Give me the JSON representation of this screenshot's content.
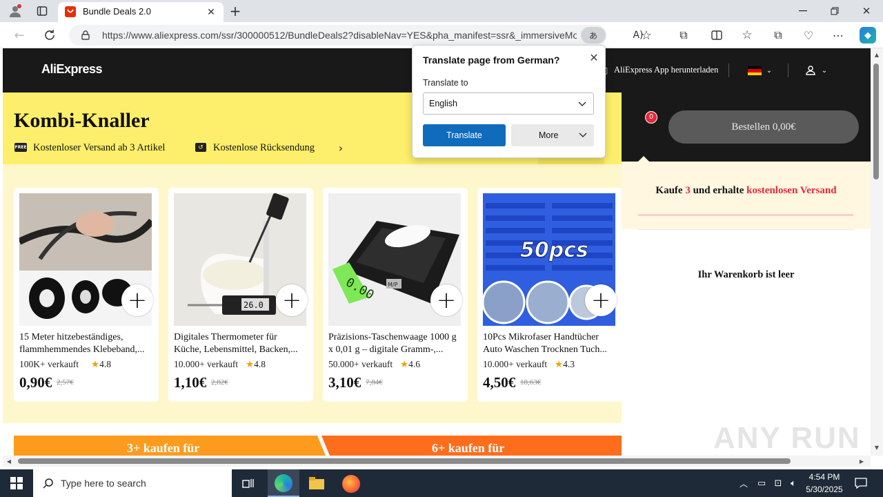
{
  "browser": {
    "tab_title": "Bundle Deals 2.0",
    "url": "https://www.aliexpress.com/ssr/300000512/BundleDeals2?disableNav=YES&pha_manifest=ssr&_immersiveMo..."
  },
  "site": {
    "logo": "AliExpress",
    "app_download": "AliExpress App herunterladen"
  },
  "banner": {
    "title": "Kombi-Knaller",
    "free_shipping_badge": "FREE",
    "free_shipping": "Kostenloser Versand ab 3 Artikel",
    "free_return": "Kostenlose Rücksendung"
  },
  "products": [
    {
      "title": "15 Meter hitzebeständiges, flammhemmendes Klebeband,...",
      "sold": "100K+ verkauft",
      "rating": "4.8",
      "price": "0,90€",
      "old_price": "2,57€"
    },
    {
      "title": "Digitales Thermometer für Küche, Lebensmittel, Backen,...",
      "sold": "10.000+ verkauft",
      "rating": "4.8",
      "price": "1,10€",
      "old_price": "2,82€"
    },
    {
      "title": "Präzisions-Taschenwaage 1000 g x 0,01 g – digitale Gramm-,...",
      "sold": "50.000+ verkauft",
      "rating": "4.6",
      "price": "3,10€",
      "old_price": "7,84€"
    },
    {
      "title": "10Pcs Mikrofaser Handtücher Auto Waschen Trocknen Tuch...",
      "sold": "10.000+ verkauft",
      "rating": "4.3",
      "price": "4,50€",
      "old_price": "18,63€"
    }
  ],
  "product_image_text": {
    "p2_display": "26.0",
    "p3_display": "0.00",
    "p3_btn": "M/P",
    "p4_label": "50pcs"
  },
  "bottom_bars": {
    "left": "3+ kaufen für",
    "right": "6+ kaufen für"
  },
  "cart": {
    "badge": "0",
    "order_button": "Bestellen 0,00€",
    "promo_pre": "Kaufe ",
    "promo_num": "3",
    "promo_mid": " und erhalte ",
    "promo_link": "kostenlosen Versand",
    "empty": "Ihr Warenkorb ist leer"
  },
  "translate_popup": {
    "title": "Translate page from German?",
    "label": "Translate to",
    "selected_language": "English",
    "translate_button": "Translate",
    "more_button": "More"
  },
  "taskbar": {
    "search_placeholder": "Type here to search",
    "time": "4:54 PM",
    "date": "5/30/2025"
  },
  "watermark": "ANY RUN",
  "colors": {
    "accent_blue": "#0f6cbd",
    "aliexpress_red": "#e62e04",
    "banner_yellow": "#fdef6b",
    "orange_bar": "#fd9b1e",
    "orange_bar2": "#fd6d1c"
  }
}
